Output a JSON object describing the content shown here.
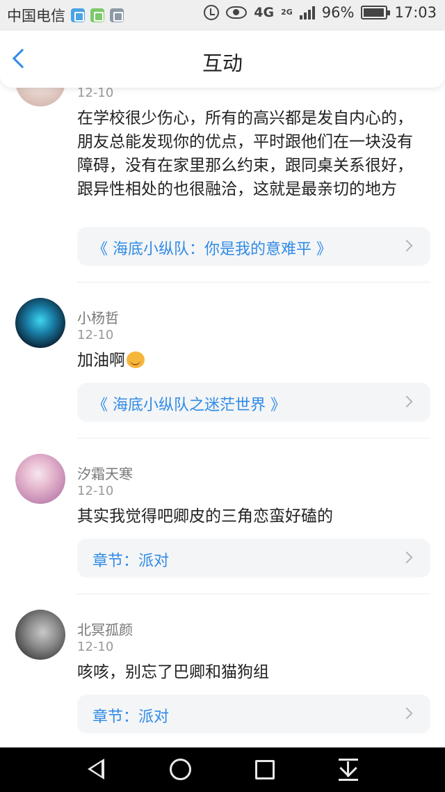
{
  "status_bar": {
    "carrier": "中国电信",
    "network": "4G",
    "network_secondary": "2G",
    "battery": "96%",
    "time": "17:03"
  },
  "header": {
    "title": "互动"
  },
  "items": [
    {
      "username": "",
      "date": "12-10",
      "content": "在学校很少伤心，所有的高兴都是发自内心的，朋友总能发现你的优点，平时跟他们在一块没有障碍，没有在家里那么约束，跟同桌关系很好，跟异性相处的也很融洽，这就是最亲切的地方",
      "card": "《 海底小纵队：你是我的意难平 》"
    },
    {
      "username": "小杨哲",
      "date": "12-10",
      "content": "加油啊",
      "card": "《 海底小纵队之迷茫世界 》"
    },
    {
      "username": "汐霜天寒",
      "date": "12-10",
      "content": "其实我觉得吧卿皮的三角恋蛮好磕的",
      "card": "章节：派对"
    },
    {
      "username": "北冥孤颜",
      "date": "12-10",
      "content": "咳咳，别忘了巴卿和猫狗组",
      "card": "章节：派对"
    }
  ],
  "colors": {
    "accent": "#2f8be6",
    "card_bg": "#f4f5f7",
    "status_bar_bg": "#efefef"
  }
}
